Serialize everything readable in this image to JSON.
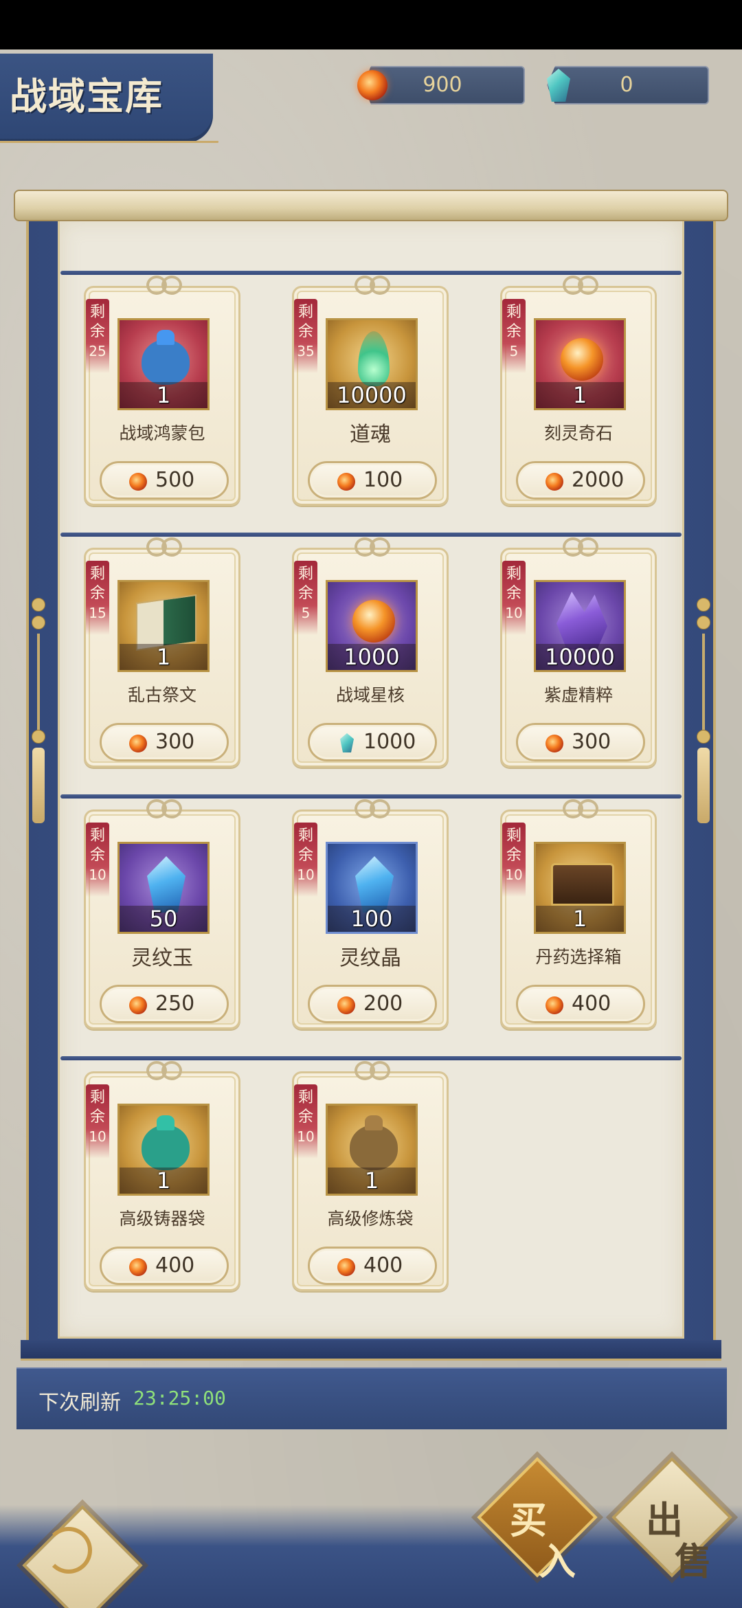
{
  "title": "战域宝库",
  "currencies": [
    {
      "icon": "fire-orb-icon",
      "value": "900"
    },
    {
      "icon": "spirit-crystal-icon",
      "value": "0"
    }
  ],
  "remain_label_1": "剩",
  "remain_label_2": "余",
  "items": [
    {
      "name": "战域鸿蒙包",
      "qty": "1",
      "remain": "25",
      "price": "500",
      "currency": "fire",
      "bg": "red",
      "art": "bag",
      "art_color": "#3a7ec8"
    },
    {
      "name": "道魂",
      "qty": "10000",
      "remain": "35",
      "price": "100",
      "currency": "fire",
      "bg": "gold",
      "art": "flame",
      "art_color": "#3fc48a"
    },
    {
      "name": "刻灵奇石",
      "qty": "1",
      "remain": "5",
      "price": "2000",
      "currency": "fire",
      "bg": "red",
      "art": "orb",
      "art_color": "#f59428"
    },
    {
      "name": "乱古祭文",
      "qty": "1",
      "remain": "15",
      "price": "300",
      "currency": "fire",
      "bg": "gold",
      "art": "book",
      "art_color": "#2c6a4a"
    },
    {
      "name": "战域星核",
      "qty": "1000",
      "remain": "5",
      "price": "1000",
      "currency": "gem",
      "bg": "purple",
      "art": "orb",
      "art_color": "#f59428"
    },
    {
      "name": "紫虚精粹",
      "qty": "10000",
      "remain": "10",
      "price": "300",
      "currency": "fire",
      "bg": "purple",
      "art": "crystal",
      "art_color": "#8a5cd8"
    },
    {
      "name": "灵纹玉",
      "qty": "50",
      "remain": "10",
      "price": "250",
      "currency": "fire",
      "bg": "purple",
      "art": "jade",
      "art_color": "#4fb2f0"
    },
    {
      "name": "灵纹晶",
      "qty": "100",
      "remain": "10",
      "price": "200",
      "currency": "fire",
      "bg": "blue",
      "art": "jade",
      "art_color": "#4fb2f0"
    },
    {
      "name": "丹药选择箱",
      "qty": "1",
      "remain": "10",
      "price": "400",
      "currency": "fire",
      "bg": "gold",
      "art": "chest",
      "art_color": "#6a4526"
    },
    {
      "name": "高级铸器袋",
      "qty": "1",
      "remain": "10",
      "price": "400",
      "currency": "fire",
      "bg": "gold",
      "art": "bag",
      "art_color": "#2aa08a"
    },
    {
      "name": "高级修炼袋",
      "qty": "1",
      "remain": "10",
      "price": "400",
      "currency": "fire",
      "bg": "gold",
      "art": "bag",
      "art_color": "#8a6a3a"
    }
  ],
  "refresh": {
    "label": "下次刷新",
    "time": "23:25:00"
  },
  "buttons": {
    "buy_1": "买",
    "buy_2": "入",
    "sell_1": "出",
    "sell_2": "售"
  }
}
